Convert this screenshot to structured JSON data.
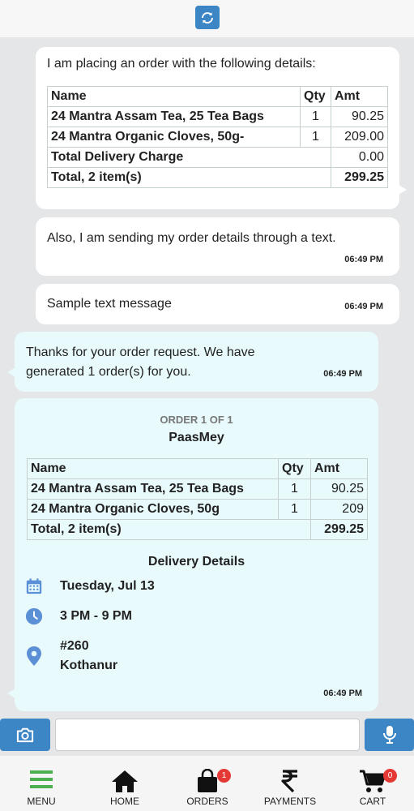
{
  "messages": {
    "m1": {
      "intro": "I am placing an order with the following details:",
      "headers": {
        "name": "Name",
        "qty": "Qty",
        "amt": "Amt"
      },
      "items": [
        {
          "name": "24 Mantra Assam Tea, 25 Tea Bags",
          "qty": "1",
          "amt": "90.25"
        },
        {
          "name": "24 Mantra Organic Cloves, 50g-",
          "qty": "1",
          "amt": "209.00"
        }
      ],
      "delivery_label": "Total Delivery Charge",
      "delivery_amt": "0.00",
      "total_label": "Total, 2 item(s)",
      "total_amt": "299.25"
    },
    "m2": {
      "text": "Also, I am sending my order details through a text.",
      "time": "06:49 PM"
    },
    "m3": {
      "text": "Sample text message",
      "time": "06:49 PM"
    },
    "m4": {
      "text": "Thanks for your order request. We have generated 1 order(s) for you.",
      "time": "06:49 PM"
    },
    "m5": {
      "order_label": "ORDER 1 OF 1",
      "store": "PaasMey",
      "headers": {
        "name": "Name",
        "qty": "Qty",
        "amt": "Amt"
      },
      "items": [
        {
          "name": "24 Mantra Assam Tea, 25 Tea Bags",
          "qty": "1",
          "amt": "90.25"
        },
        {
          "name": "24 Mantra Organic Cloves, 50g",
          "qty": "1",
          "amt": "209"
        }
      ],
      "total_label": "Total, 2 item(s)",
      "total_amt": "299.25",
      "delivery_title": "Delivery Details",
      "date": "Tuesday, Jul 13",
      "time_slot": "3 PM - 9 PM",
      "address_line1": "#260",
      "address_line2": "Kothanur",
      "time": "06:49 PM"
    }
  },
  "input": {
    "placeholder": ""
  },
  "nav": {
    "menu": "MENU",
    "home": "HOME",
    "orders": "ORDERS",
    "orders_badge": "1",
    "payments": "PAYMENTS",
    "cart": "CART",
    "cart_badge": "0"
  },
  "icons": {
    "refresh": "refresh-icon",
    "camera": "camera-icon",
    "mic": "microphone-icon",
    "calendar": "calendar-icon",
    "clock": "clock-icon",
    "location": "location-pin-icon"
  },
  "colors": {
    "accent": "#3d86c6",
    "menu_green": "#4caf50",
    "badge": "#e53935",
    "icon_blue": "#5b8fd6"
  }
}
